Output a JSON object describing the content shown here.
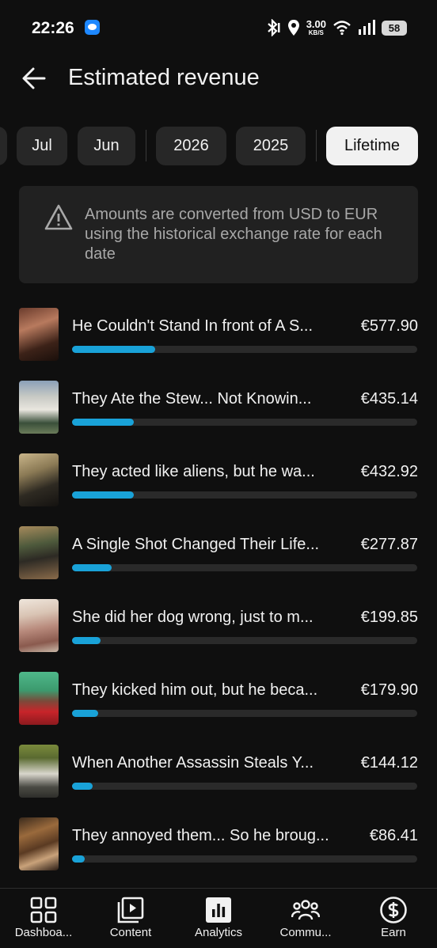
{
  "status_bar": {
    "time": "22:26",
    "net_speed_value": "3.00",
    "net_speed_unit": "KB/S",
    "battery": "58"
  },
  "header": {
    "title": "Estimated revenue"
  },
  "chips": [
    {
      "label": "Jul",
      "selected": false
    },
    {
      "label": "Jun",
      "selected": false
    },
    {
      "label": "2026",
      "selected": false
    },
    {
      "label": "2025",
      "selected": false
    },
    {
      "label": "Lifetime",
      "selected": true
    }
  ],
  "notice": {
    "icon": "warning-icon",
    "text": "Amounts are converted from USD to EUR using the historical exchange rate for each date"
  },
  "videos": [
    {
      "title": "He Couldn't Stand In front of A S...",
      "amount": "€577.90",
      "progress": 0.24
    },
    {
      "title": "They Ate the Stew... Not Knowin...",
      "amount": "€435.14",
      "progress": 0.18
    },
    {
      "title": "They acted like aliens, but he wa...",
      "amount": "€432.92",
      "progress": 0.18
    },
    {
      "title": "A Single Shot Changed Their Life...",
      "amount": "€277.87",
      "progress": 0.115
    },
    {
      "title": "She did her dog wrong, just to m...",
      "amount": "€199.85",
      "progress": 0.083
    },
    {
      "title": "They kicked him out, but he beca...",
      "amount": "€179.90",
      "progress": 0.075
    },
    {
      "title": "When Another Assassin Steals Y...",
      "amount": "€144.12",
      "progress": 0.06
    },
    {
      "title": "They annoyed them... So he broug...",
      "amount": "€86.41",
      "progress": 0.036
    }
  ],
  "bottom_nav": [
    {
      "label": "Dashboa...",
      "icon": "dashboard-icon"
    },
    {
      "label": "Content",
      "icon": "content-icon"
    },
    {
      "label": "Analytics",
      "icon": "analytics-icon"
    },
    {
      "label": "Commu...",
      "icon": "community-icon"
    },
    {
      "label": "Earn",
      "icon": "earn-icon"
    }
  ],
  "colors": {
    "background": "#0f0f0f",
    "progress_fill": "#19a2d8",
    "progress_track": "#2a2a2a",
    "chip": "#272727",
    "chip_selected": "#f1f1f1",
    "notice_bg": "#212121"
  }
}
